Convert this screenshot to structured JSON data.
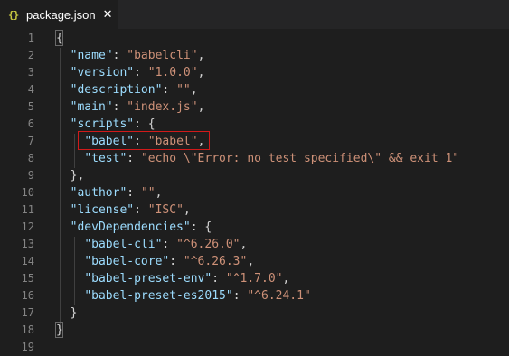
{
  "tab": {
    "icon": "{}",
    "icon_name": "json-braces-icon",
    "label": "package.json",
    "close_glyph": "✕"
  },
  "editor": {
    "lines": [
      {
        "num": "1",
        "tokens": [
          {
            "t": "punc",
            "v": "{"
          }
        ]
      },
      {
        "num": "2",
        "tokens": [
          {
            "t": "ws",
            "v": "  "
          },
          {
            "t": "key",
            "v": "\"name\""
          },
          {
            "t": "punc",
            "v": ": "
          },
          {
            "t": "str",
            "v": "\"babelcli\""
          },
          {
            "t": "punc",
            "v": ","
          }
        ]
      },
      {
        "num": "3",
        "tokens": [
          {
            "t": "ws",
            "v": "  "
          },
          {
            "t": "key",
            "v": "\"version\""
          },
          {
            "t": "punc",
            "v": ": "
          },
          {
            "t": "str",
            "v": "\"1.0.0\""
          },
          {
            "t": "punc",
            "v": ","
          }
        ]
      },
      {
        "num": "4",
        "tokens": [
          {
            "t": "ws",
            "v": "  "
          },
          {
            "t": "key",
            "v": "\"description\""
          },
          {
            "t": "punc",
            "v": ": "
          },
          {
            "t": "str",
            "v": "\"\""
          },
          {
            "t": "punc",
            "v": ","
          }
        ]
      },
      {
        "num": "5",
        "tokens": [
          {
            "t": "ws",
            "v": "  "
          },
          {
            "t": "key",
            "v": "\"main\""
          },
          {
            "t": "punc",
            "v": ": "
          },
          {
            "t": "str",
            "v": "\"index.js\""
          },
          {
            "t": "punc",
            "v": ","
          }
        ]
      },
      {
        "num": "6",
        "tokens": [
          {
            "t": "ws",
            "v": "  "
          },
          {
            "t": "key",
            "v": "\"scripts\""
          },
          {
            "t": "punc",
            "v": ": {"
          }
        ]
      },
      {
        "num": "7",
        "tokens": [
          {
            "t": "ws",
            "v": "    "
          },
          {
            "t": "key",
            "v": "\"babel\""
          },
          {
            "t": "punc",
            "v": ": "
          },
          {
            "t": "str",
            "v": "\"babel\""
          },
          {
            "t": "punc",
            "v": ","
          }
        ]
      },
      {
        "num": "8",
        "tokens": [
          {
            "t": "ws",
            "v": "    "
          },
          {
            "t": "key",
            "v": "\"test\""
          },
          {
            "t": "punc",
            "v": ": "
          },
          {
            "t": "str",
            "v": "\"echo \\\"Error: no test specified\\\" && exit 1\""
          }
        ]
      },
      {
        "num": "9",
        "tokens": [
          {
            "t": "ws",
            "v": "  "
          },
          {
            "t": "punc",
            "v": "},"
          }
        ]
      },
      {
        "num": "10",
        "tokens": [
          {
            "t": "ws",
            "v": "  "
          },
          {
            "t": "key",
            "v": "\"author\""
          },
          {
            "t": "punc",
            "v": ": "
          },
          {
            "t": "str",
            "v": "\"\""
          },
          {
            "t": "punc",
            "v": ","
          }
        ]
      },
      {
        "num": "11",
        "tokens": [
          {
            "t": "ws",
            "v": "  "
          },
          {
            "t": "key",
            "v": "\"license\""
          },
          {
            "t": "punc",
            "v": ": "
          },
          {
            "t": "str",
            "v": "\"ISC\""
          },
          {
            "t": "punc",
            "v": ","
          }
        ]
      },
      {
        "num": "12",
        "tokens": [
          {
            "t": "ws",
            "v": "  "
          },
          {
            "t": "key",
            "v": "\"devDependencies\""
          },
          {
            "t": "punc",
            "v": ": {"
          }
        ]
      },
      {
        "num": "13",
        "tokens": [
          {
            "t": "ws",
            "v": "    "
          },
          {
            "t": "key",
            "v": "\"babel-cli\""
          },
          {
            "t": "punc",
            "v": ": "
          },
          {
            "t": "str",
            "v": "\"^6.26.0\""
          },
          {
            "t": "punc",
            "v": ","
          }
        ]
      },
      {
        "num": "14",
        "tokens": [
          {
            "t": "ws",
            "v": "    "
          },
          {
            "t": "key",
            "v": "\"babel-core\""
          },
          {
            "t": "punc",
            "v": ": "
          },
          {
            "t": "str",
            "v": "\"^6.26.3\""
          },
          {
            "t": "punc",
            "v": ","
          }
        ]
      },
      {
        "num": "15",
        "tokens": [
          {
            "t": "ws",
            "v": "    "
          },
          {
            "t": "key",
            "v": "\"babel-preset-env\""
          },
          {
            "t": "punc",
            "v": ": "
          },
          {
            "t": "str",
            "v": "\"^1.7.0\""
          },
          {
            "t": "punc",
            "v": ","
          }
        ]
      },
      {
        "num": "16",
        "tokens": [
          {
            "t": "ws",
            "v": "    "
          },
          {
            "t": "key",
            "v": "\"babel-preset-es2015\""
          },
          {
            "t": "punc",
            "v": ": "
          },
          {
            "t": "str",
            "v": "\"^6.24.1\""
          }
        ]
      },
      {
        "num": "17",
        "tokens": [
          {
            "t": "ws",
            "v": "  "
          },
          {
            "t": "punc",
            "v": "}"
          }
        ]
      },
      {
        "num": "18",
        "tokens": [
          {
            "t": "punc",
            "v": "}"
          }
        ]
      },
      {
        "num": "19",
        "tokens": []
      }
    ]
  },
  "colors": {
    "background": "#1e1e1e",
    "tabbar": "#252526",
    "key": "#9cdcfe",
    "string": "#ce9178",
    "punctuation": "#d4d4d4",
    "line_number": "#858585",
    "highlight_border": "#d11a1a",
    "json_icon": "#cbcb41"
  }
}
